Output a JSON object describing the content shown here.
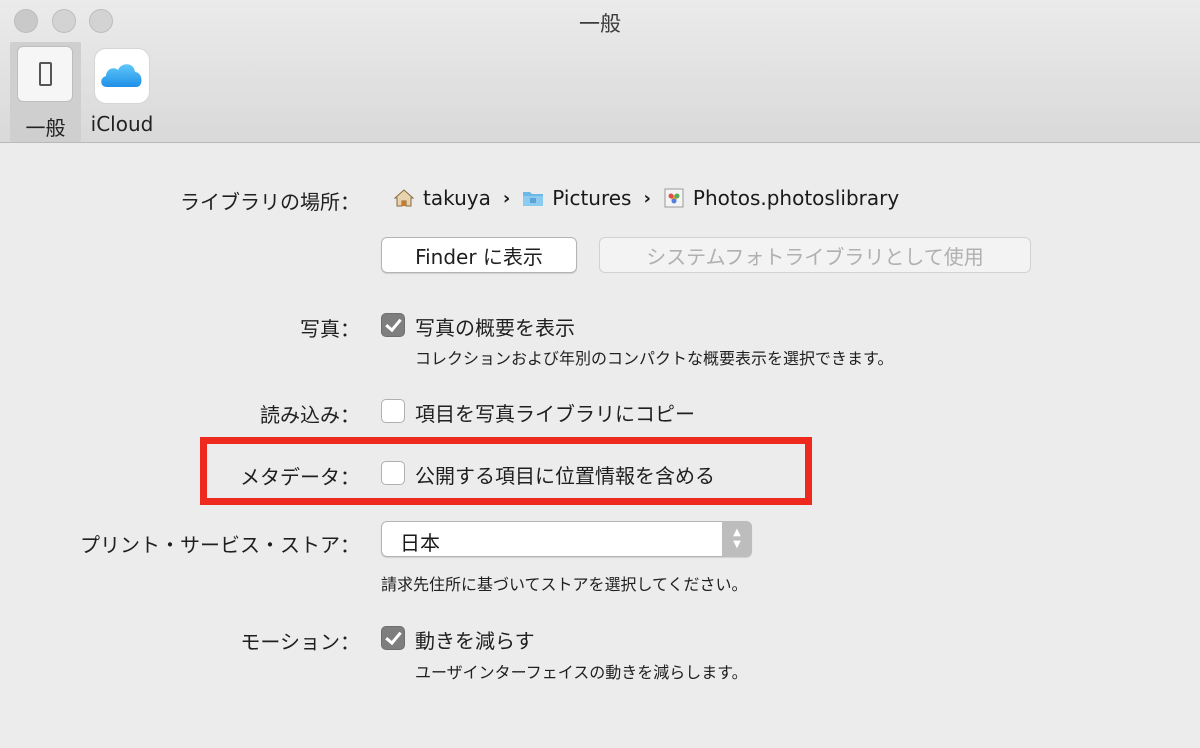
{
  "window": {
    "title": "一般"
  },
  "toolbar": {
    "items": [
      {
        "label": "一般",
        "icon": "general-switch-icon",
        "selected": true
      },
      {
        "label": "iCloud",
        "icon": "icloud-icon",
        "selected": false
      }
    ]
  },
  "library": {
    "label": "ライブラリの場所：",
    "path": [
      {
        "name": "takuya",
        "icon": "home-icon"
      },
      {
        "name": "Pictures",
        "icon": "folder-icon"
      },
      {
        "name": "Photos.photoslibrary",
        "icon": "photos-library-icon"
      }
    ],
    "show_in_finder": "Finder に表示",
    "use_as_system": "システムフォトライブラリとして使用"
  },
  "photos": {
    "label": "写真：",
    "checkbox_label": "写真の概要を表示",
    "checked": true,
    "description": "コレクションおよび年別のコンパクトな概要表示を選択できます。"
  },
  "import": {
    "label": "読み込み：",
    "checkbox_label": "項目を写真ライブラリにコピー",
    "checked": false
  },
  "metadata": {
    "label": "メタデータ：",
    "checkbox_label": "公開する項目に位置情報を含める",
    "checked": false,
    "highlight_color": "#ee2a1f"
  },
  "print_store": {
    "label": "プリント・サービス・ストア：",
    "selected": "日本",
    "description": "請求先住所に基づいてストアを選択してください。"
  },
  "motion": {
    "label": "モーション：",
    "checkbox_label": "動きを減らす",
    "checked": true,
    "description": "ユーザインターフェイスの動きを減らします。"
  }
}
